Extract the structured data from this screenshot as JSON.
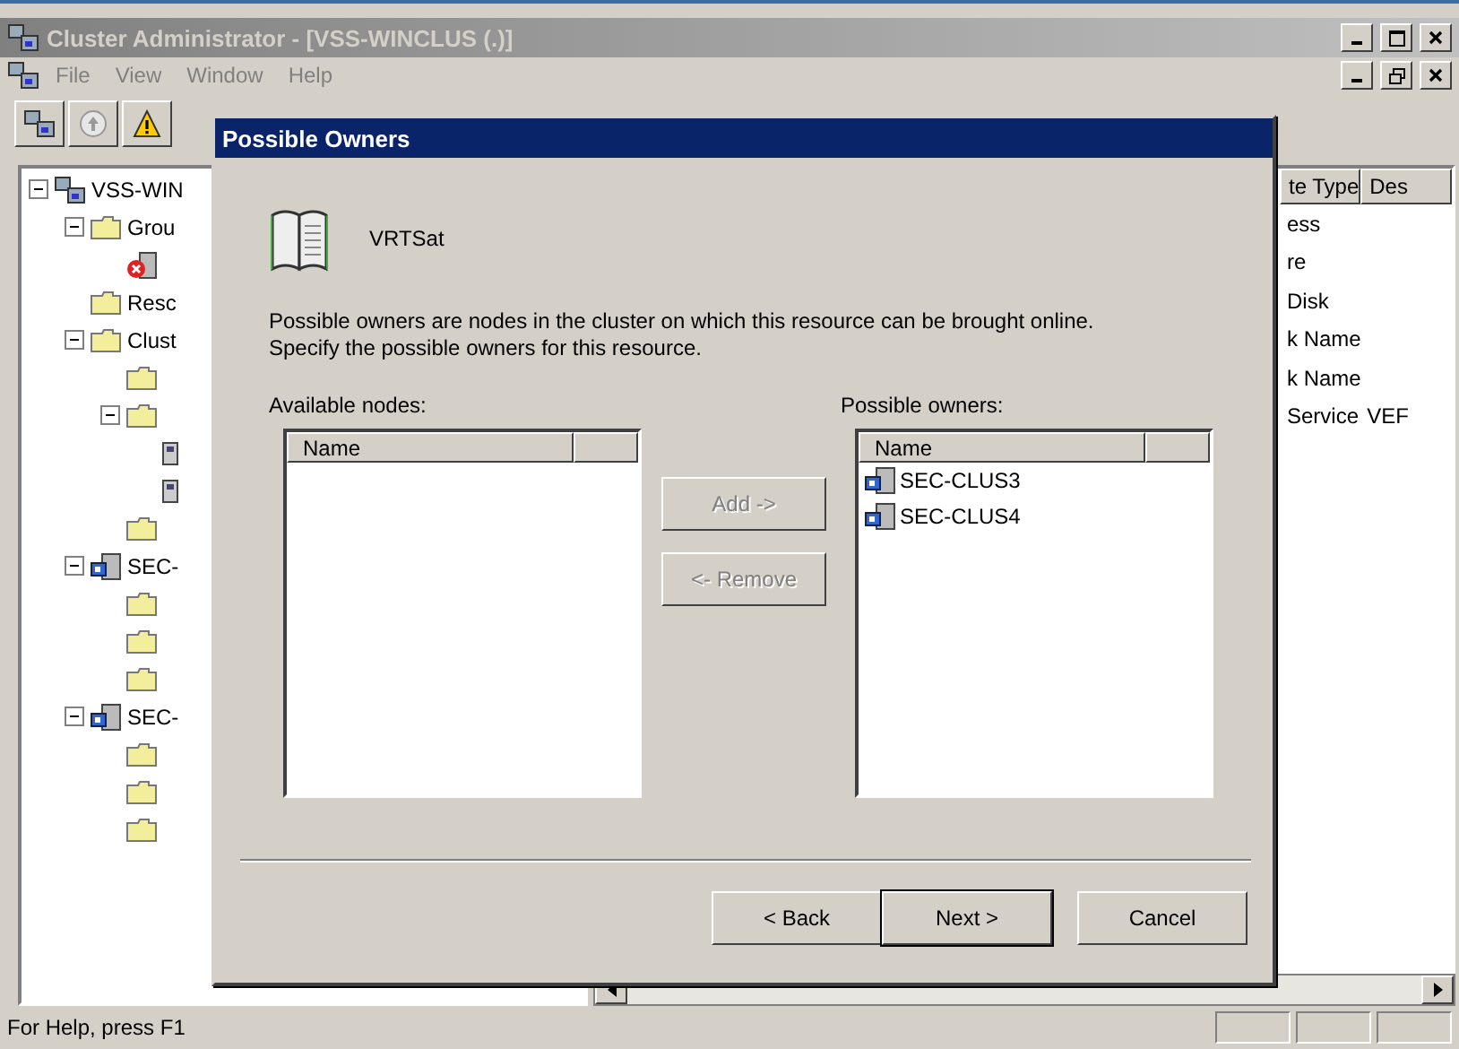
{
  "window": {
    "title": "Cluster Administrator - [VSS-WINCLUS (.)]"
  },
  "menu": [
    "File",
    "View",
    "Window",
    "Help"
  ],
  "toolbar": [
    {
      "kind": "cluster"
    },
    {
      "kind": "up"
    },
    {
      "kind": "warning"
    }
  ],
  "tree": [
    {
      "label": "VSS-WIN",
      "kind": "cluster",
      "expanded": true,
      "children": [
        {
          "label": "Grou",
          "kind": "folder",
          "expanded": true,
          "children": [
            {
              "kind": "server-error"
            }
          ]
        },
        {
          "label": "Resc",
          "kind": "folder"
        },
        {
          "label": "Clust",
          "kind": "folder",
          "expanded": true,
          "children": [
            {
              "kind": "folder"
            },
            {
              "kind": "folder",
              "expanded": true,
              "children": [
                {
                  "kind": "network"
                },
                {
                  "kind": "network"
                }
              ]
            },
            {
              "kind": "folder"
            }
          ]
        },
        {
          "label": "SEC-",
          "kind": "server",
          "expanded": true,
          "children": [
            {
              "kind": "folder"
            },
            {
              "kind": "folder"
            },
            {
              "kind": "folder"
            }
          ]
        },
        {
          "label": "SEC-",
          "kind": "server",
          "expanded": true,
          "children": [
            {
              "kind": "folder"
            },
            {
              "kind": "folder"
            },
            {
              "kind": "folder"
            }
          ]
        }
      ]
    }
  ],
  "list": {
    "columns": [
      "te Type",
      "Des"
    ],
    "rows": [
      {
        "cells": [
          "ess"
        ]
      },
      {
        "cells": [
          "re"
        ]
      },
      {
        "cells": [
          "Disk"
        ]
      },
      {
        "cells": [
          "k Name"
        ]
      },
      {
        "cells": [
          "k Name"
        ]
      },
      {
        "cells": [
          "Service",
          "VEF"
        ]
      }
    ]
  },
  "dialog": {
    "title": "Possible Owners",
    "resource": "VRTSat",
    "description": [
      "Possible owners are nodes in the cluster on which this resource can be brought online.",
      "Specify the possible owners for this resource."
    ],
    "available": {
      "label": "Available nodes:",
      "column": "Name"
    },
    "owners": {
      "label": "Possible owners:",
      "column": "Name",
      "items": [
        "SEC-CLUS3",
        "SEC-CLUS4"
      ]
    },
    "move_buttons": [
      {
        "label": "Add ->",
        "disabled": true
      },
      {
        "label": "<- Remove",
        "disabled": true
      }
    ],
    "buttons": [
      {
        "label": "< Back",
        "default": false
      },
      {
        "label": "Next >",
        "default": true
      },
      {
        "label": "Cancel",
        "default": false
      }
    ]
  },
  "status_bar": {
    "text": "For Help, press F1"
  }
}
